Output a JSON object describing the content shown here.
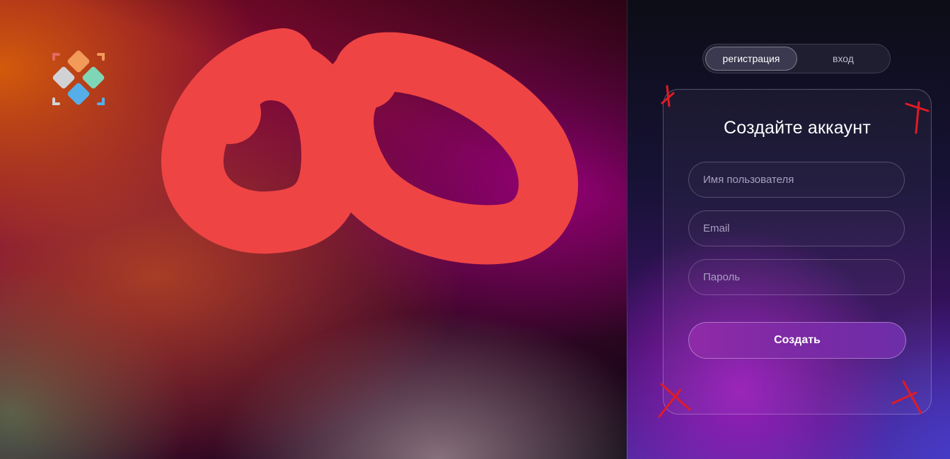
{
  "brand": {
    "logo_icon": "multi-diamond-logo-icon",
    "colors": [
      "#f19a5a",
      "#d0d2d6",
      "#7fd6b6",
      "#56aee8",
      "#e46b62"
    ]
  },
  "tabs": [
    {
      "label": "регистрация",
      "active": true
    },
    {
      "label": "вход",
      "active": false
    }
  ],
  "form": {
    "title": "Создайте аккаунт",
    "username_placeholder": "Имя пользователя",
    "email_placeholder": "Email",
    "password_placeholder": "Пароль",
    "submit_label": "Создать"
  },
  "annotations": {
    "scribble_color": "#ef4444",
    "cross_color": "#e01b24"
  }
}
